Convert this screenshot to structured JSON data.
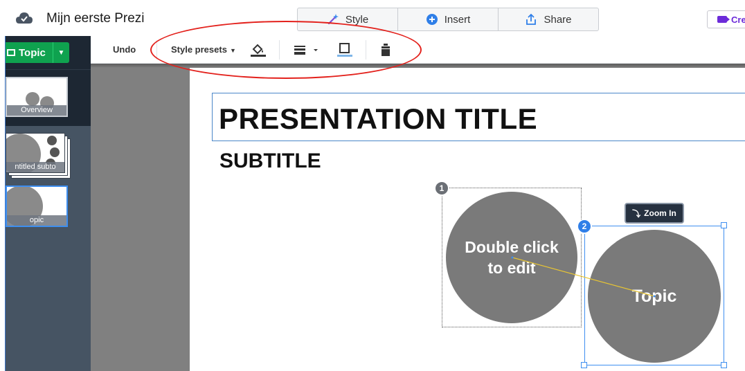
{
  "header": {
    "doc_title": "Mijn eerste Prezi",
    "tabs": [
      {
        "label": "Style",
        "icon": "magic-wand-icon"
      },
      {
        "label": "Insert",
        "icon": "plus-circle-icon"
      },
      {
        "label": "Share",
        "icon": "share-upload-icon"
      }
    ],
    "create_label": "Cre",
    "cloud_icon": "cloud-saved-icon"
  },
  "sidebar": {
    "topic_button": "Topic",
    "thumbnails": [
      {
        "label": "Overview"
      },
      {
        "label": "ntitled subto"
      },
      {
        "label": "opic"
      }
    ]
  },
  "toolbar": {
    "undo": "Undo",
    "style_presets": "Style presets",
    "icons": [
      "fill-bucket-icon",
      "line-weight-icon",
      "border-icon",
      "delete-icon"
    ]
  },
  "canvas": {
    "title": "PRESENTATION TITLE",
    "subtitle": "SUBTITLE",
    "topic1_text": "Double click to edit",
    "topic1_number": "1",
    "topic2_text": "Topic",
    "topic2_number": "2",
    "zoom_in": "Zoom In"
  },
  "colors": {
    "accent_green": "#0fa24f",
    "selection_blue": "#3d8ef0",
    "annotation_red": "#e3211c",
    "circle_gray": "#7a7a7a",
    "sidebar_dark": "#1d2733"
  }
}
